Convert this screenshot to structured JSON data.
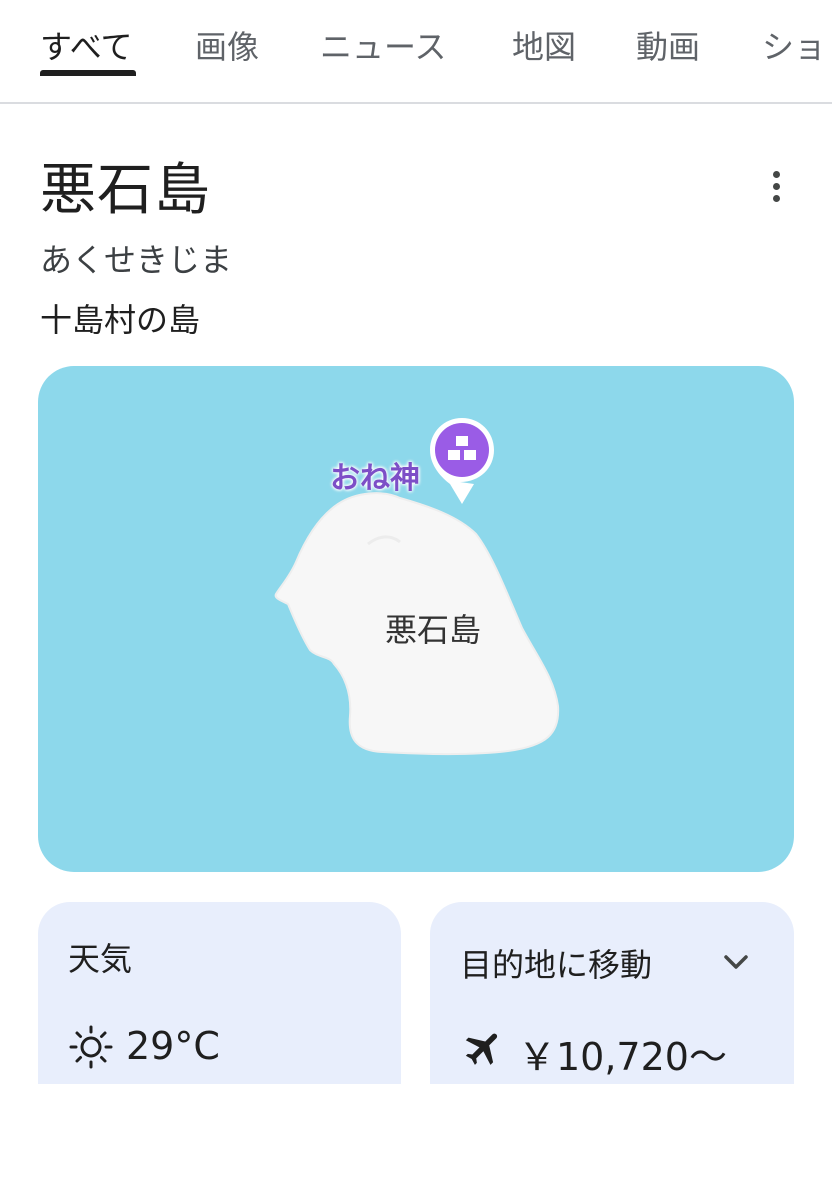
{
  "tabs": [
    {
      "label": "すべて"
    },
    {
      "label": "画像"
    },
    {
      "label": "ニュース"
    },
    {
      "label": "地図"
    },
    {
      "label": "動画"
    },
    {
      "label": "ショ"
    }
  ],
  "entity": {
    "title": "悪石島",
    "reading": "あくせきじま",
    "description": "十島村の島"
  },
  "map": {
    "island_label": "悪石島",
    "poi_label": "おね神",
    "water_color": "#8dd8eb",
    "land_color": "#f7f7f7",
    "poi_color": "#9a5ce6"
  },
  "weather": {
    "title": "天気",
    "icon": "sun-icon",
    "temperature": "29°C"
  },
  "travel": {
    "title": "目的地に移動",
    "icon": "airplane-icon",
    "price": "￥10,720〜"
  }
}
